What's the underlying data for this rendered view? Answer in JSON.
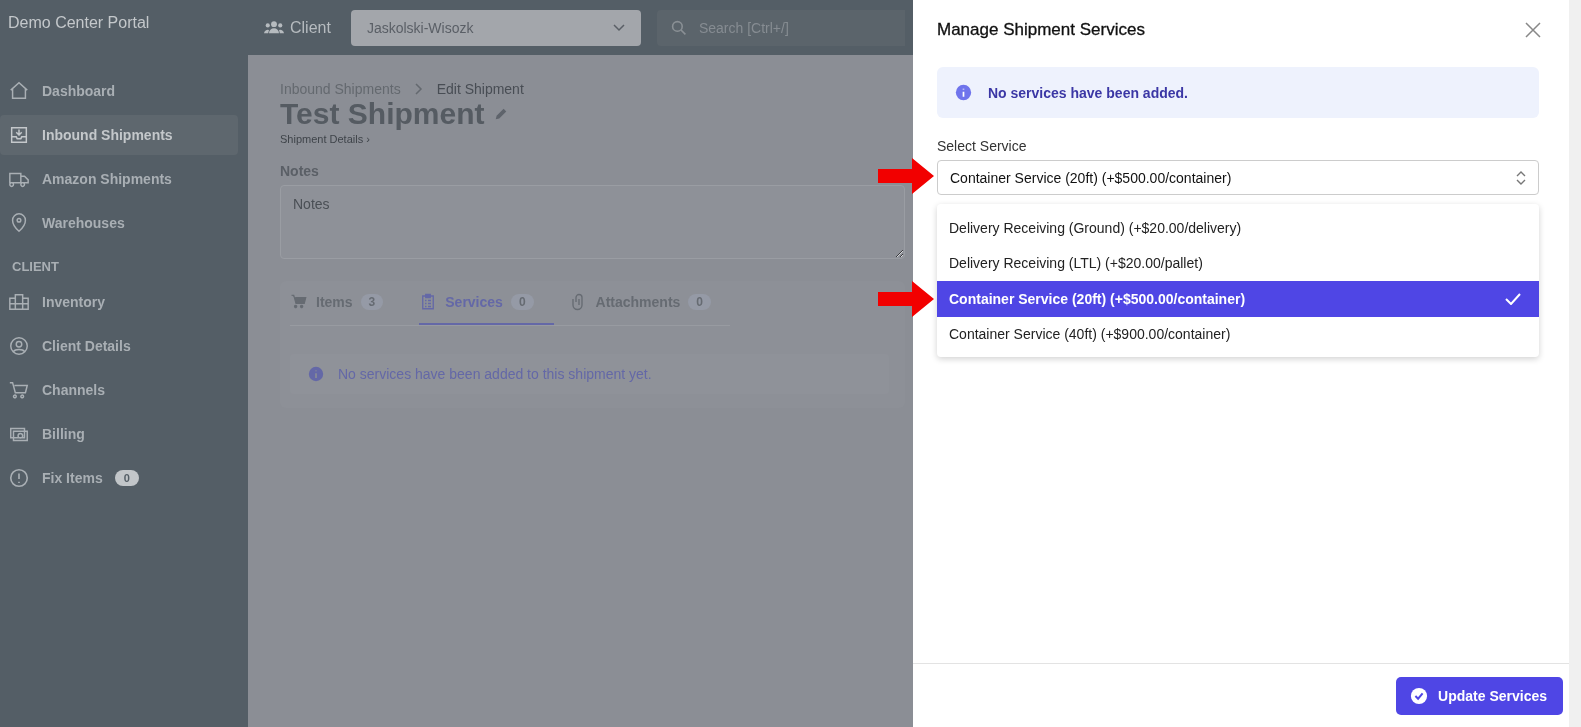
{
  "app": {
    "title": "Demo Center Portal"
  },
  "topbar": {
    "client_label": "Client",
    "client_select": "Jaskolski-Wisozk",
    "search": {
      "placeholder": "Search [Ctrl+/]"
    }
  },
  "sidebar": {
    "items": [
      {
        "label": "Dashboard",
        "selected": false
      },
      {
        "label": "Inbound Shipments",
        "selected": true
      },
      {
        "label": "Amazon Shipments",
        "selected": false
      },
      {
        "label": "Warehouses",
        "selected": false
      }
    ],
    "section": "CLIENT",
    "client_items": [
      {
        "label": "Inventory",
        "selected": false
      },
      {
        "label": "Client Details",
        "selected": false
      },
      {
        "label": "Channels",
        "selected": false
      },
      {
        "label": "Billing",
        "selected": false
      },
      {
        "label": "Fix Items",
        "selected": false,
        "badge": "0"
      }
    ]
  },
  "page": {
    "breadcrumbs": [
      "Inbound Shipments",
      "Edit Shipment"
    ],
    "title": "Test Shipment",
    "subtitle": "Shipment Details ›",
    "notes": {
      "label": "Notes",
      "placeholder": "Notes"
    },
    "tabs": [
      {
        "label": "Items",
        "count": "3",
        "selected": false
      },
      {
        "label": "Services",
        "count": "0",
        "selected": true
      },
      {
        "label": "Attachments",
        "count": "0",
        "selected": false
      }
    ],
    "empty_message": "No services have been added to this shipment yet."
  },
  "panel": {
    "title": "Manage Shipment Services",
    "alert": "No services have been added.",
    "select_label": "Select Service",
    "select_value": "Container Service (20ft) (+$500.00/container)",
    "options": [
      {
        "label": "Delivery Receiving (Ground) (+$20.00/delivery)",
        "selected": false
      },
      {
        "label": "Delivery Receiving (LTL) (+$20.00/pallet)",
        "selected": false
      },
      {
        "label": "Container Service (20ft) (+$500.00/container)",
        "selected": true
      },
      {
        "label": "Container Service (40ft) (+$900.00/container)",
        "selected": false
      }
    ],
    "submit": "Update Services"
  }
}
